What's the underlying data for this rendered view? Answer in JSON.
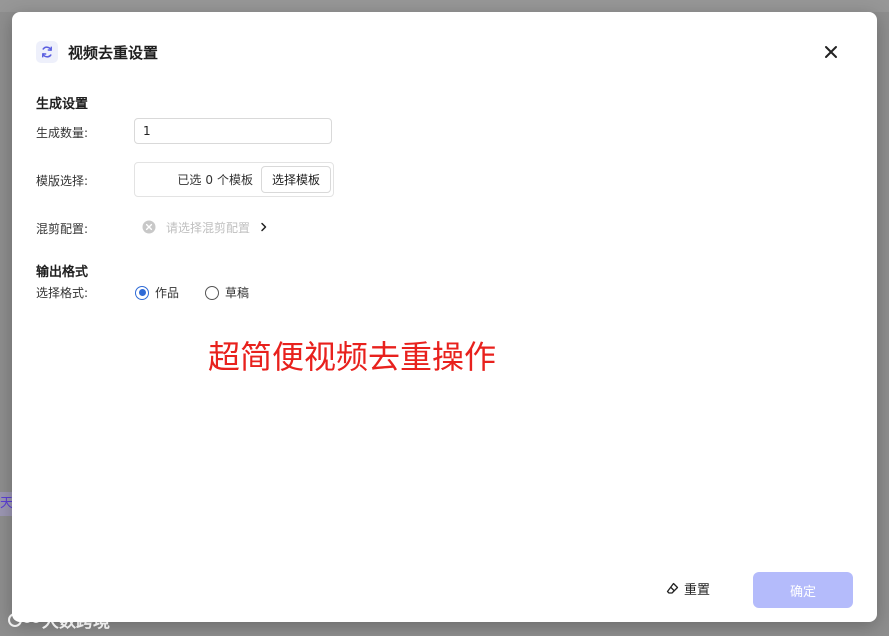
{
  "dialog": {
    "title": "视频去重设置"
  },
  "generate_settings": {
    "section_title": "生成设置",
    "quantity_label": "生成数量:",
    "quantity_value": "1",
    "template_label": "模版选择:",
    "template_selected_prefix": "已选",
    "template_selected_count": "0",
    "template_selected_suffix": "个模板",
    "template_button": "选择模板",
    "mix_label": "混剪配置:",
    "mix_placeholder": "请选择混剪配置"
  },
  "output_format": {
    "section_title": "输出格式",
    "format_label": "选择格式:",
    "options": [
      {
        "label": "作品",
        "checked": true
      },
      {
        "label": "草稿",
        "checked": false
      }
    ]
  },
  "overlay_caption": "超简便视频去重操作",
  "footer": {
    "reset_label": "重置",
    "confirm_label": "确定"
  },
  "backdrop": {
    "left_fragment": "天",
    "watermark": "大数跨境"
  },
  "colors": {
    "accent": "#2f6bd6",
    "confirm_disabled": "#b4bbfb",
    "caption": "#e8211d"
  }
}
